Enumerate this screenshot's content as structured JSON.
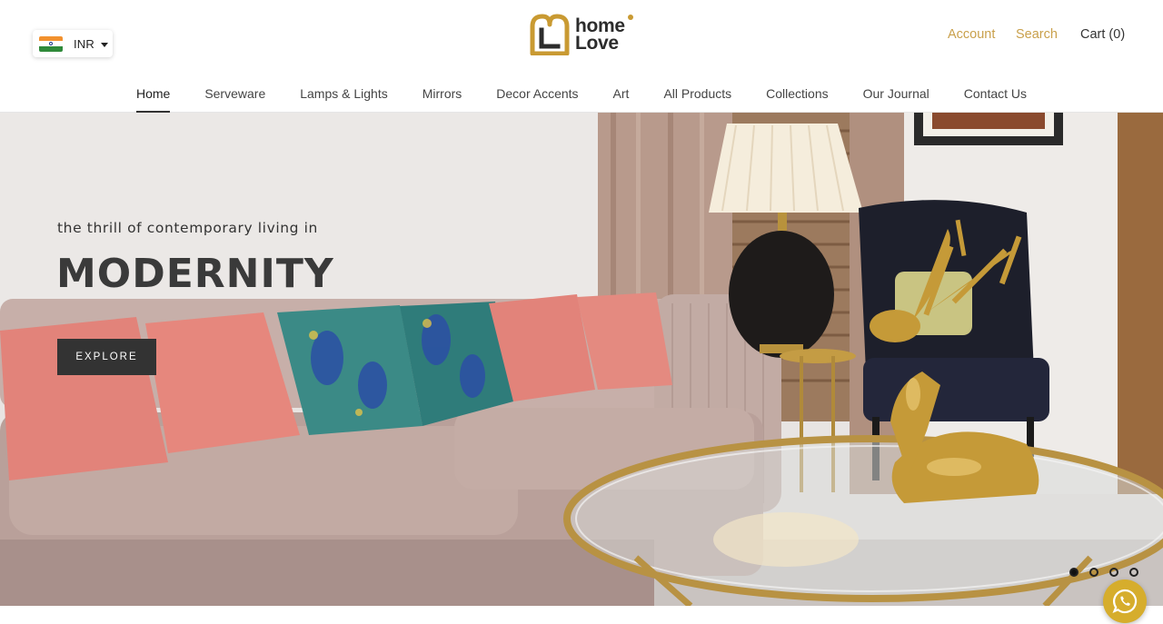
{
  "currency": {
    "code": "INR",
    "flag_icon": "india-flag-icon"
  },
  "brand": {
    "line1": "home",
    "line2": "Love",
    "accent_color": "#c99a32"
  },
  "utility": {
    "account": "Account",
    "search": "Search",
    "cart": "Cart (0)",
    "accent_color": "#c9a04b"
  },
  "nav": {
    "items": [
      {
        "label": "Home",
        "active": true
      },
      {
        "label": "Serveware"
      },
      {
        "label": "Lamps & Lights"
      },
      {
        "label": "Mirrors"
      },
      {
        "label": "Decor Accents"
      },
      {
        "label": "Art"
      },
      {
        "label": "All Products"
      },
      {
        "label": "Collections"
      },
      {
        "label": "Our Journal"
      },
      {
        "label": "Contact Us"
      }
    ]
  },
  "hero": {
    "subtitle": "the thrill of contemporary living in",
    "title": "MODERNITY",
    "cta": "EXPLORE",
    "slides_count": 4,
    "active_slide": 1
  },
  "chat": {
    "icon": "whatsapp-icon",
    "color": "#d6ad2c"
  }
}
